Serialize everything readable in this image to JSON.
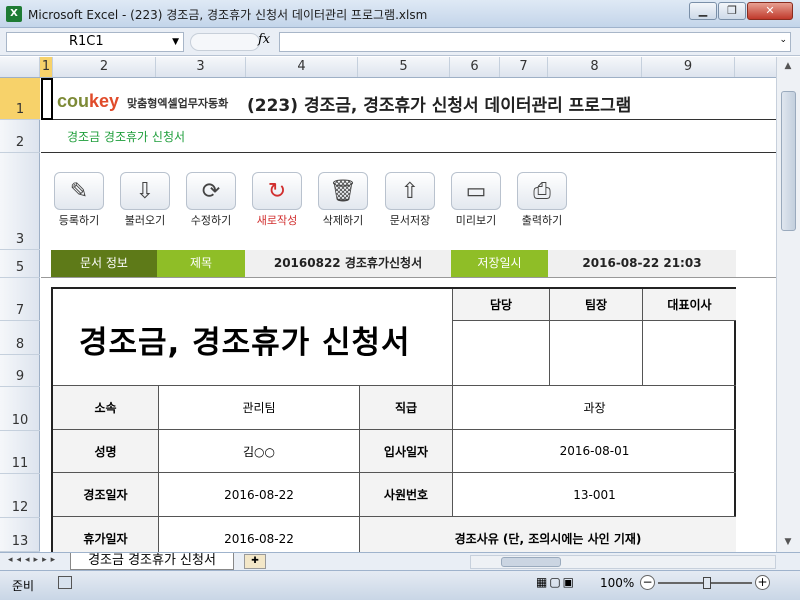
{
  "window": {
    "title": "Microsoft Excel - (223) 경조금, 경조휴가 신청서 데이터관리 프로그램.xlsm",
    "minimize": "▁",
    "restore": "❐",
    "close": "✕"
  },
  "formula_bar": {
    "name_box": "R1C1",
    "fx": "fx",
    "value": ""
  },
  "columns": [
    "1",
    "2",
    "3",
    "4",
    "5",
    "6",
    "7",
    "8",
    "9"
  ],
  "rows": [
    "1",
    "2",
    "3",
    "5",
    "7",
    "8",
    "9",
    "10",
    "11",
    "12",
    "13"
  ],
  "header": {
    "logo_main": "cou",
    "logo_k": "key",
    "logo_sub": "맞춤형엑셀업무자동화",
    "doc_title": "(223) 경조금, 경조휴가 신청서 데이터관리 프로그램",
    "subtitle": "경조금 경조휴가 신청서"
  },
  "toolbar": [
    {
      "label": "등록하기",
      "icon": "✎"
    },
    {
      "label": "불러오기",
      "icon": "⇩"
    },
    {
      "label": "수정하기",
      "icon": "⟳"
    },
    {
      "label": "새로작성",
      "icon": "↻"
    },
    {
      "label": "삭제하기",
      "icon": "🗑"
    },
    {
      "label": "문서저장",
      "icon": "⇧"
    },
    {
      "label": "미리보기",
      "icon": "▭"
    },
    {
      "label": "출력하기",
      "icon": "⎙"
    }
  ],
  "doc_info": {
    "info_label": "문서 정보",
    "title_label": "제목",
    "title_value": "20160822 경조휴가신청서",
    "saved_label": "저장일시",
    "saved_value": "2016-08-22 21:03"
  },
  "form": {
    "big_title": "경조금, 경조휴가 신청서",
    "approvals": [
      "담당",
      "팀장",
      "대표이사"
    ],
    "affiliation_label": "소속",
    "affiliation_value": "관리팀",
    "position_label": "직급",
    "position_value": "과장",
    "name_label": "성명",
    "name_value": "김○○",
    "hire_label": "입사일자",
    "hire_value": "2016-08-01",
    "event_date_label": "경조일자",
    "event_date_value": "2016-08-22",
    "empno_label": "사원번호",
    "empno_value": "13-001",
    "leave_label": "휴가일자",
    "leave_value": "2016-08-22",
    "reason_label": "경조사유 (단, 조의시에는 사인 기재)"
  },
  "sheet_tab": "경조금 경조휴가 신청서",
  "status": {
    "ready": "준비",
    "zoom": "100%"
  }
}
